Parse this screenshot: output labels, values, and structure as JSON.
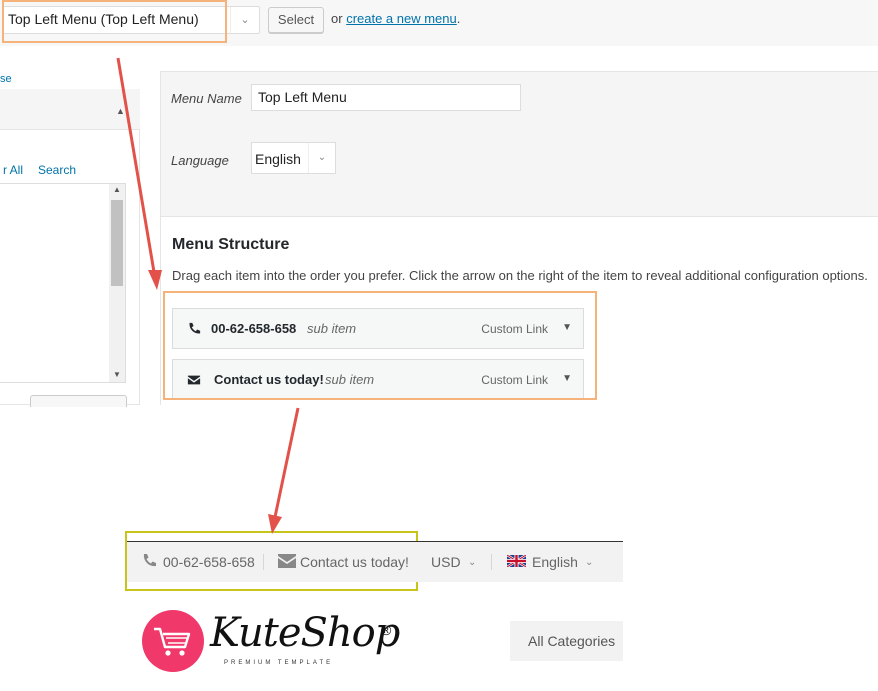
{
  "menu_selector": {
    "selected": "Top Left Menu (Top Left Menu)",
    "select_button": "Select",
    "or_text": "or",
    "create_link": "create a new menu",
    "period": "."
  },
  "left_panel": {
    "collapse_link_partial": "se",
    "tabs": [
      {
        "label": "r All"
      },
      {
        "label": "Search"
      }
    ]
  },
  "menu_settings": {
    "name_label": "Menu Name",
    "name_value": "Top Left Menu",
    "language_label": "Language",
    "language_value": "English"
  },
  "menu_structure": {
    "title": "Menu Structure",
    "description": "Drag each item into the order you prefer. Click the arrow on the right of the item to reveal additional configuration options.",
    "items": [
      {
        "icon": "phone-icon",
        "title": "00-62-658-658",
        "sub": "sub item",
        "type": "Custom Link"
      },
      {
        "icon": "envelope-icon",
        "title": "Contact us today!",
        "sub": "sub item",
        "type": "Custom Link"
      }
    ]
  },
  "frontend": {
    "phone": "00-62-658-658",
    "contact": "Contact us today!",
    "currency": "USD",
    "language": "English",
    "logo_text": "KuteShop",
    "logo_reg": "®",
    "logo_tagline": "PREMIUM TEMPLATE",
    "categories": "All Categories"
  },
  "colors": {
    "highlight_orange": "#f5b27a",
    "highlight_olive": "#c7c51a",
    "arrow": "#e3524a",
    "link": "#0073aa",
    "logo_pink": "#f0386b"
  }
}
